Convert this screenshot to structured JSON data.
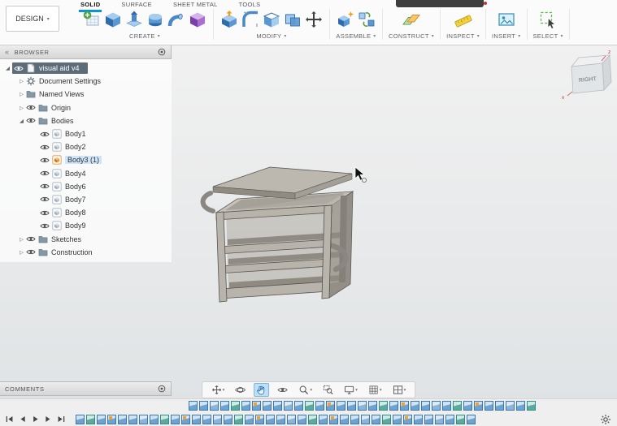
{
  "colors": {
    "active_tab_underline": "#0696d7",
    "selected_row_bg": "#5c6d79",
    "body_highlight": "#cfe6f8",
    "selected_body_orange": "#ea9636"
  },
  "toolbar": {
    "design_menu_label": "DESIGN",
    "tabs": [
      {
        "label": "SOLID",
        "active": true
      },
      {
        "label": "SURFACE",
        "active": false
      },
      {
        "label": "SHEET METAL",
        "active": false
      },
      {
        "label": "TOOLS",
        "active": false
      }
    ],
    "groups": [
      {
        "label": "CREATE",
        "icons": [
          "create-sketch-icon",
          "box-icon",
          "extrude-icon",
          "revolve-icon",
          "sweep-icon",
          "form-icon"
        ]
      },
      {
        "label": "MODIFY",
        "icons": [
          "press-pull-icon",
          "fillet-icon",
          "shell-icon",
          "combine-icon",
          "move-copy-icon"
        ]
      },
      {
        "label": "ASSEMBLE",
        "icons": [
          "new-component-icon",
          "joint-icon"
        ]
      },
      {
        "label": "CONSTRUCT",
        "icons": [
          "construction-plane-icon"
        ]
      },
      {
        "label": "INSPECT",
        "icons": [
          "measure-icon"
        ]
      },
      {
        "label": "INSERT",
        "icons": [
          "insert-image-icon"
        ]
      },
      {
        "label": "SELECT",
        "icons": [
          "select-icon"
        ]
      }
    ]
  },
  "browser": {
    "title": "BROWSER",
    "tree": [
      {
        "label": "visual aid v4",
        "level": 0,
        "icon": "document-icon",
        "eye": true,
        "expander": "expanded",
        "selected": true
      },
      {
        "label": "Document Settings",
        "level": 1,
        "icon": "gear-icon",
        "expander": "collapsed"
      },
      {
        "label": "Named Views",
        "level": 1,
        "icon": "folder-icon",
        "expander": "collapsed"
      },
      {
        "label": "Origin",
        "level": 1,
        "icon": "folder-icon",
        "eye": true,
        "expander": "collapsed"
      },
      {
        "label": "Bodies",
        "level": 1,
        "icon": "folder-icon",
        "eye": true,
        "expander": "expanded"
      },
      {
        "label": "Body1",
        "level": 2,
        "icon": "body-icon",
        "eye": true
      },
      {
        "label": "Body2",
        "level": 2,
        "icon": "body-icon",
        "eye": true
      },
      {
        "label": "Body3 (1)",
        "level": 2,
        "icon": "body-orange-icon",
        "eye": true,
        "highlight": true
      },
      {
        "label": "Body4",
        "level": 2,
        "icon": "body-icon",
        "eye": true
      },
      {
        "label": "Body6",
        "level": 2,
        "icon": "body-icon",
        "eye": true
      },
      {
        "label": "Body7",
        "level": 2,
        "icon": "body-icon",
        "eye": true
      },
      {
        "label": "Body8",
        "level": 2,
        "icon": "body-icon",
        "eye": true
      },
      {
        "label": "Body9",
        "level": 2,
        "icon": "body-icon",
        "eye": true
      },
      {
        "label": "Sketches",
        "level": 1,
        "icon": "folder-icon",
        "eye": true,
        "expander": "collapsed"
      },
      {
        "label": "Construction",
        "level": 1,
        "icon": "folder-icon",
        "eye": true,
        "expander": "collapsed"
      }
    ]
  },
  "viewcube": {
    "face_label": "RIGHT",
    "axis_labels": [
      "z",
      "x"
    ]
  },
  "comments": {
    "title": "COMMENTS"
  },
  "navbar": {
    "icons": [
      {
        "name": "pan-icon",
        "dropdown": true,
        "active": false
      },
      {
        "name": "orbit-icon",
        "dropdown": false,
        "active": false
      },
      {
        "name": "hand-icon",
        "dropdown": false,
        "active": true
      },
      {
        "name": "look-at-icon",
        "dropdown": false,
        "active": false
      },
      {
        "name": "zoom-icon",
        "dropdown": true,
        "active": false
      },
      {
        "name": "zoom-window-icon",
        "dropdown": false,
        "active": false
      },
      {
        "name": "display-settings-icon",
        "dropdown": true,
        "active": false
      },
      {
        "name": "grid-display-icon",
        "dropdown": true,
        "active": false
      },
      {
        "name": "viewports-icon",
        "dropdown": true,
        "active": false
      }
    ]
  },
  "timeline": {
    "playback_icons": [
      "skip-to-start-icon",
      "step-back-icon",
      "play-icon",
      "step-forward-icon",
      "skip-to-end-icon"
    ],
    "overflow_row_feature_count": 33,
    "main_row_feature_count": 38
  }
}
